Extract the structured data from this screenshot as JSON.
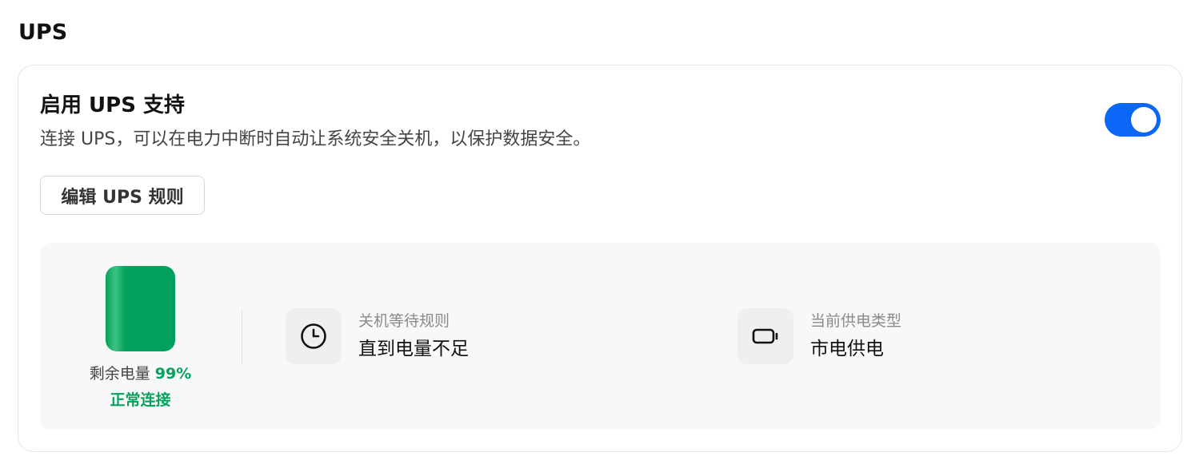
{
  "section": {
    "title": "UPS"
  },
  "ups_card": {
    "title": "启用 UPS 支持",
    "description": "连接 UPS，可以在电力中断时自动让系统安全关机，以保护数据安全。",
    "toggle_enabled": true,
    "edit_button_label": "编辑 UPS 规则"
  },
  "status": {
    "battery_label": "剩余电量",
    "battery_percent": "99%",
    "battery_level": 0.99,
    "connection_status": "正常连接",
    "shutdown_rule": {
      "icon": "clock-icon",
      "label": "关机等待规则",
      "value": "直到电量不足"
    },
    "power_source": {
      "icon": "battery-icon",
      "label": "当前供电类型",
      "value": "市电供电"
    }
  },
  "colors": {
    "accent": "#0a66f5",
    "success": "#07a15e"
  }
}
